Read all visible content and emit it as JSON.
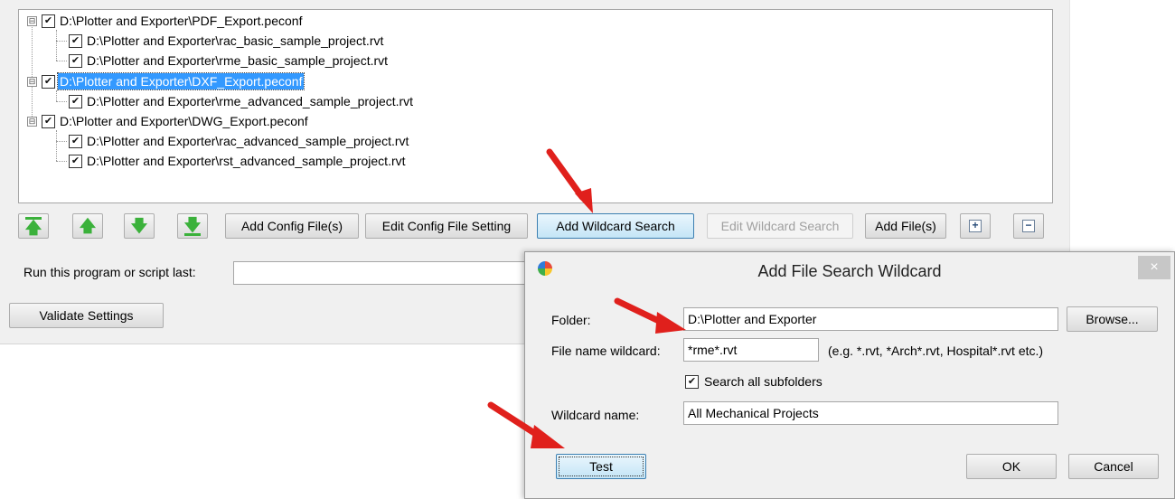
{
  "tree": {
    "items": [
      {
        "label": "D:\\Plotter and Exporter\\PDF_Export.peconf",
        "level": 0,
        "checked": true,
        "selected": false,
        "expander": "⊟"
      },
      {
        "label": "D:\\Plotter  and  Exporter\\rac_basic_sample_project.rvt",
        "level": 1,
        "checked": true,
        "selected": false
      },
      {
        "label": "D:\\Plotter  and  Exporter\\rme_basic_sample_project.rvt",
        "level": 1,
        "checked": true,
        "selected": false
      },
      {
        "label": "D:\\Plotter and Exporter\\DXF_Export.peconf",
        "level": 0,
        "checked": true,
        "selected": true,
        "expander": "⊟"
      },
      {
        "label": "D:\\Plotter  and  Exporter\\rme_advanced_sample_project.rvt",
        "level": 1,
        "checked": true,
        "selected": false
      },
      {
        "label": "D:\\Plotter and Exporter\\DWG_Export.peconf",
        "level": 0,
        "checked": true,
        "selected": false,
        "expander": "⊟"
      },
      {
        "label": "D:\\Plotter  and  Exporter\\rac_advanced_sample_project.rvt",
        "level": 1,
        "checked": true,
        "selected": false
      },
      {
        "label": "D:\\Plotter  and  Exporter\\rst_advanced_sample_project.rvt",
        "level": 1,
        "checked": true,
        "selected": false
      }
    ]
  },
  "toolbar": {
    "move_top_icon": "move-to-top-icon",
    "move_up_icon": "move-up-icon",
    "move_down_icon": "move-down-icon",
    "move_bottom_icon": "move-to-bottom-icon",
    "add_config": "Add Config File(s)",
    "edit_config": "Edit  Config  File Setting",
    "add_wildcard": "Add Wildcard Search",
    "edit_wildcard": "Edit Wildcard Search",
    "add_files": "Add File(s)",
    "expand_all": "+",
    "collapse_all": "−"
  },
  "run_last": {
    "label": "Run this program or script last:",
    "value": ""
  },
  "validate_button": "Validate Settings",
  "dialog": {
    "title": "Add File Search Wildcard",
    "close": "×",
    "folder_label": "Folder:",
    "folder_value": "D:\\Plotter and Exporter",
    "browse": "Browse...",
    "wildcard_label": "File name wildcard:",
    "wildcard_value": "*rme*.rvt",
    "wildcard_hint": "(e.g. *.rvt, *Arch*.rvt, Hospital*.rvt etc.)",
    "subfolders_label": "Search all subfolders",
    "subfolders_checked": true,
    "name_label": "Wildcard name:",
    "name_value": "All Mechanical Projects",
    "test": "Test",
    "ok": "OK",
    "cancel": "Cancel"
  },
  "colors": {
    "selection": "#3399ff",
    "arrow_green": "#3bb13b",
    "annotation_red": "#e0201c"
  }
}
